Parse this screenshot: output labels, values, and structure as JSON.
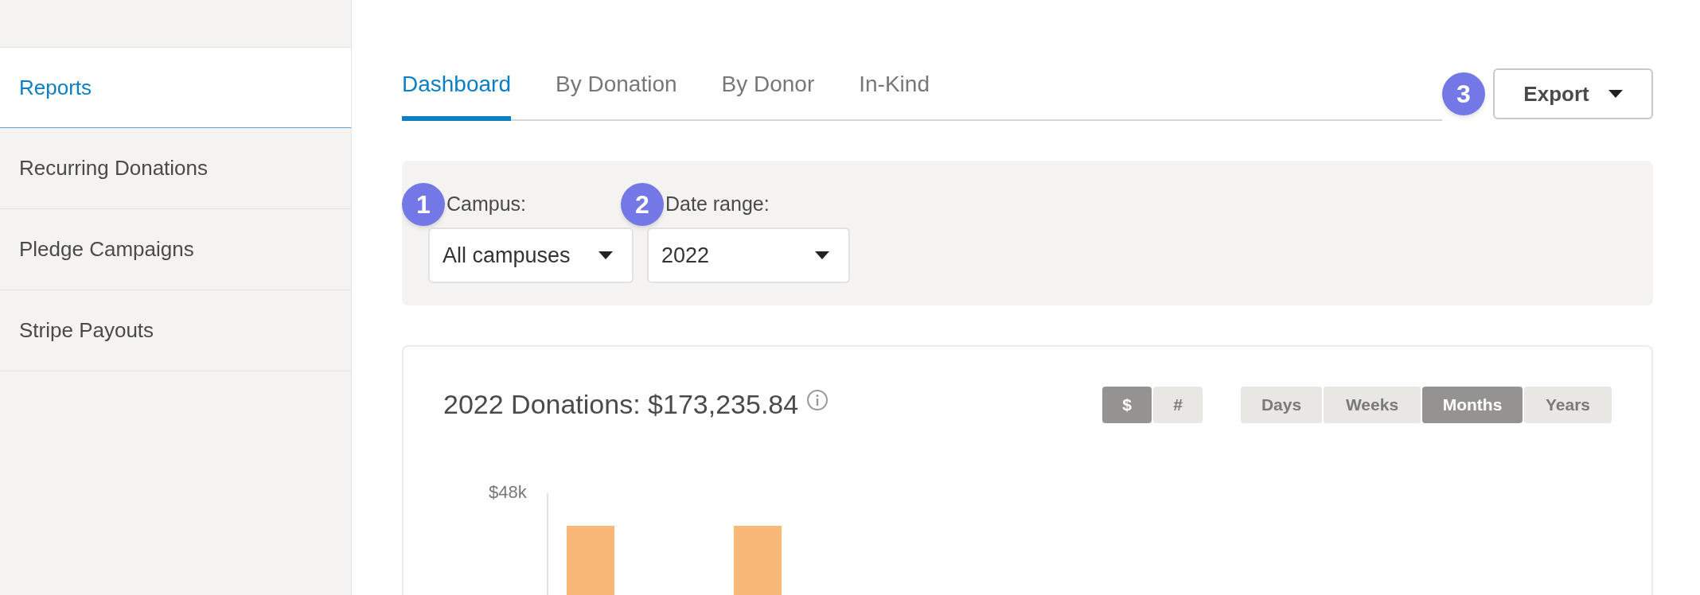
{
  "sidebar": {
    "items": [
      {
        "label": "Reports",
        "selected": true
      },
      {
        "label": "Recurring Donations",
        "selected": false
      },
      {
        "label": "Pledge Campaigns",
        "selected": false
      },
      {
        "label": "Stripe Payouts",
        "selected": false
      }
    ]
  },
  "tabs": [
    {
      "label": "Dashboard",
      "selected": true
    },
    {
      "label": "By Donation",
      "selected": false
    },
    {
      "label": "By Donor",
      "selected": false
    },
    {
      "label": "In-Kind",
      "selected": false
    }
  ],
  "export": {
    "badge": "3",
    "label": "Export"
  },
  "filters": [
    {
      "badge": "1",
      "label": "Campus:",
      "value": "All campuses"
    },
    {
      "badge": "2",
      "label": "Date range:",
      "value": "2022"
    }
  ],
  "card": {
    "title": "2022 Donations: $173,235.84",
    "metric_toggle": [
      {
        "label": "$",
        "selected": true
      },
      {
        "label": "#",
        "selected": false
      }
    ],
    "period_toggle": [
      {
        "label": "Days",
        "selected": false
      },
      {
        "label": "Weeks",
        "selected": false
      },
      {
        "label": "Months",
        "selected": true
      },
      {
        "label": "Years",
        "selected": false
      }
    ],
    "chart": {
      "y_tick": "$48k"
    }
  }
}
